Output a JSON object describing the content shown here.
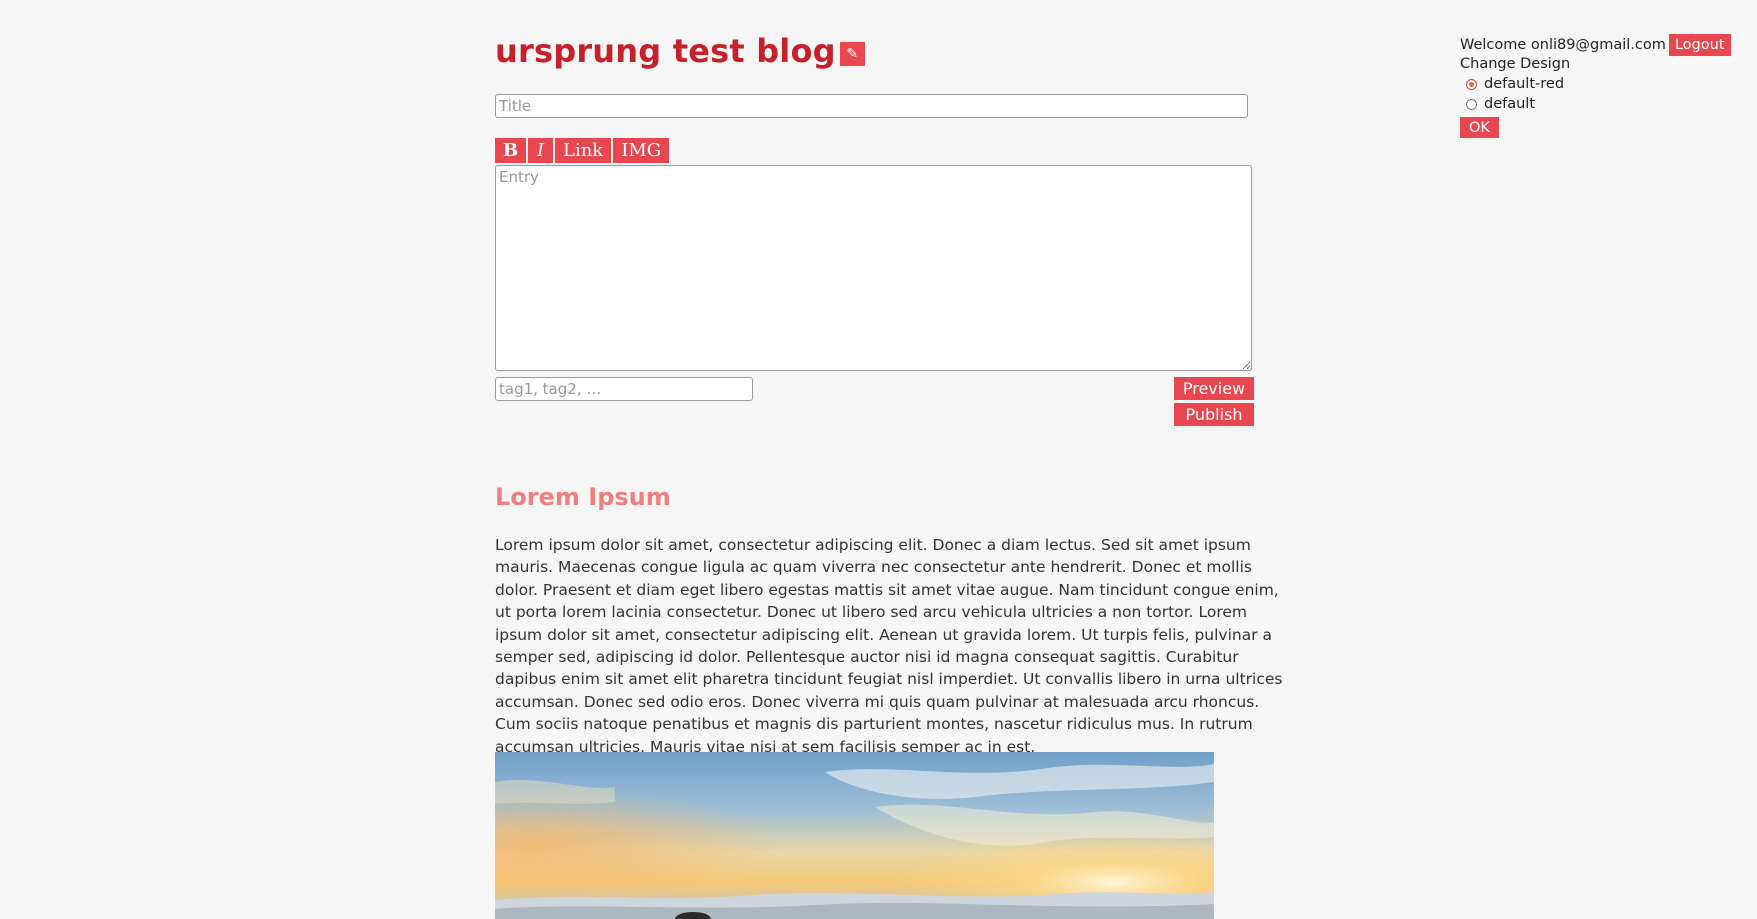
{
  "header": {
    "blog_title": "ursprung test blog",
    "edit_icon_glyph": "✎"
  },
  "editor": {
    "title_placeholder": "Title",
    "toolbar": {
      "bold": "B",
      "italic": "I",
      "link": "Link",
      "img": "IMG"
    },
    "entry_placeholder": "Entry",
    "tags_placeholder": "tag1, tag2, …",
    "preview_label": "Preview",
    "publish_label": "Publish"
  },
  "post": {
    "title": "Lorem Ipsum",
    "body": "Lorem ipsum dolor sit amet, consectetur adipiscing elit. Donec a diam lectus. Sed sit amet ipsum mauris. Maecenas congue ligula ac quam viverra nec consectetur ante hendrerit. Donec et mollis dolor. Praesent et diam eget libero egestas mattis sit amet vitae augue. Nam tincidunt congue enim, ut porta lorem lacinia consectetur. Donec ut libero sed arcu vehicula ultricies a non tortor. Lorem ipsum dolor sit amet, consectetur adipiscing elit. Aenean ut gravida lorem. Ut turpis felis, pulvinar a semper sed, adipiscing id dolor. Pellentesque auctor nisi id magna consequat sagittis. Curabitur dapibus enim sit amet elit pharetra tincidunt feugiat nisl imperdiet. Ut convallis libero in urna ultrices accumsan. Donec sed odio eros. Donec viverra mi quis quam pulvinar at malesuada arcu rhoncus. Cum sociis natoque penatibus et magnis dis parturient montes, nascetur ridiculus mus. In rutrum accumsan ultricies. Mauris vitae nisi at sem facilisis semper ac in est."
  },
  "sidebar": {
    "welcome": "Welcome onli89@gmail.com",
    "logout_label": "Logout",
    "change_design_label": "Change Design",
    "designs": [
      {
        "label": "default-red",
        "checked": true
      },
      {
        "label": "default",
        "checked": false
      }
    ],
    "ok_label": "OK"
  },
  "colors": {
    "accent": "#e8474f",
    "title_red": "#c8202a",
    "post_title": "#f07f7f",
    "background": "#f6f6f6"
  }
}
